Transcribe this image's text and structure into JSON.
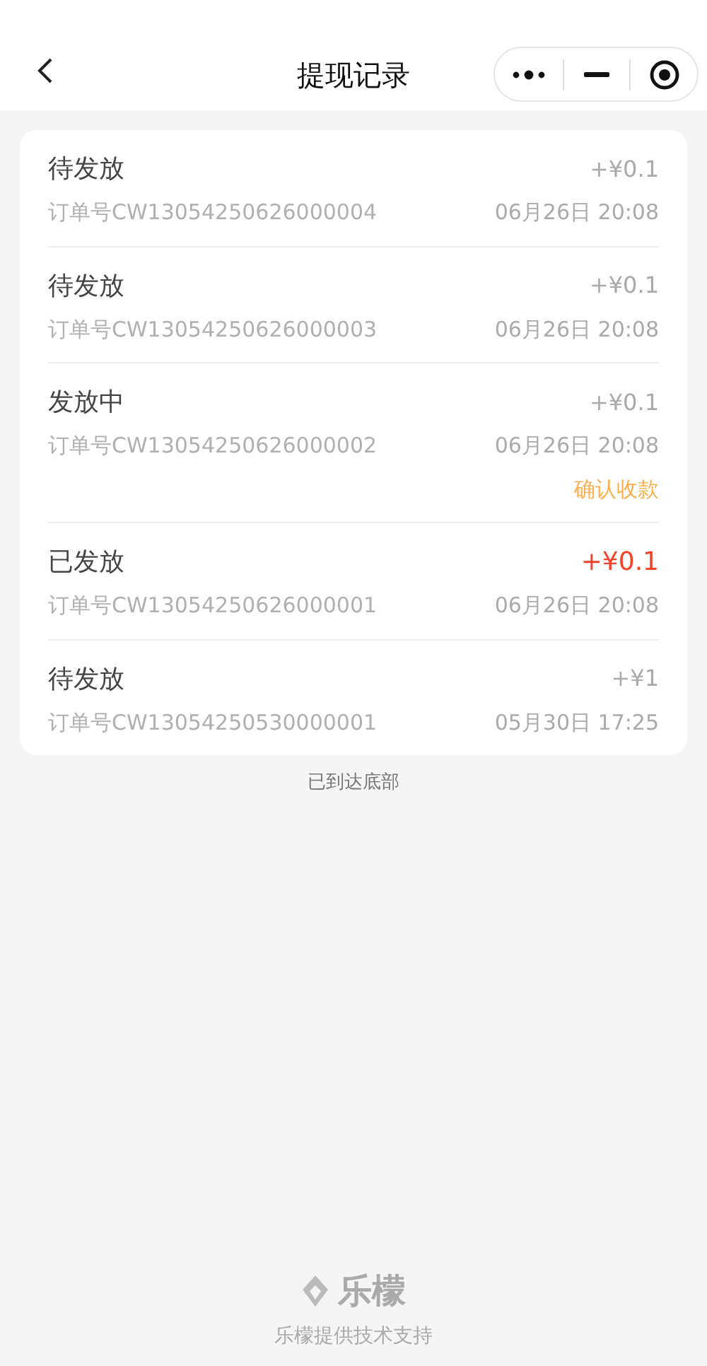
{
  "nav": {
    "title": "提现记录"
  },
  "records": [
    {
      "status": "待发放",
      "amount": "+¥0.1",
      "highlighted": false,
      "order": "订单号CW13054250626000004",
      "time": "06月26日 20:08"
    },
    {
      "status": "待发放",
      "amount": "+¥0.1",
      "highlighted": false,
      "order": "订单号CW13054250626000003",
      "time": "06月26日 20:08"
    },
    {
      "status": "发放中",
      "amount": "+¥0.1",
      "highlighted": false,
      "order": "订单号CW13054250626000002",
      "time": "06月26日 20:08",
      "action": "确认收款"
    },
    {
      "status": "已发放",
      "amount": "+¥0.1",
      "highlighted": true,
      "order": "订单号CW13054250626000001",
      "time": "06月26日 20:08"
    },
    {
      "status": "待发放",
      "amount": "+¥1",
      "highlighted": false,
      "order": "订单号CW13054250530000001",
      "time": "05月30日 17:25"
    }
  ],
  "end_note": "已到达底部",
  "footer": {
    "brand": "乐檬",
    "credit": "乐檬提供技术支持"
  }
}
